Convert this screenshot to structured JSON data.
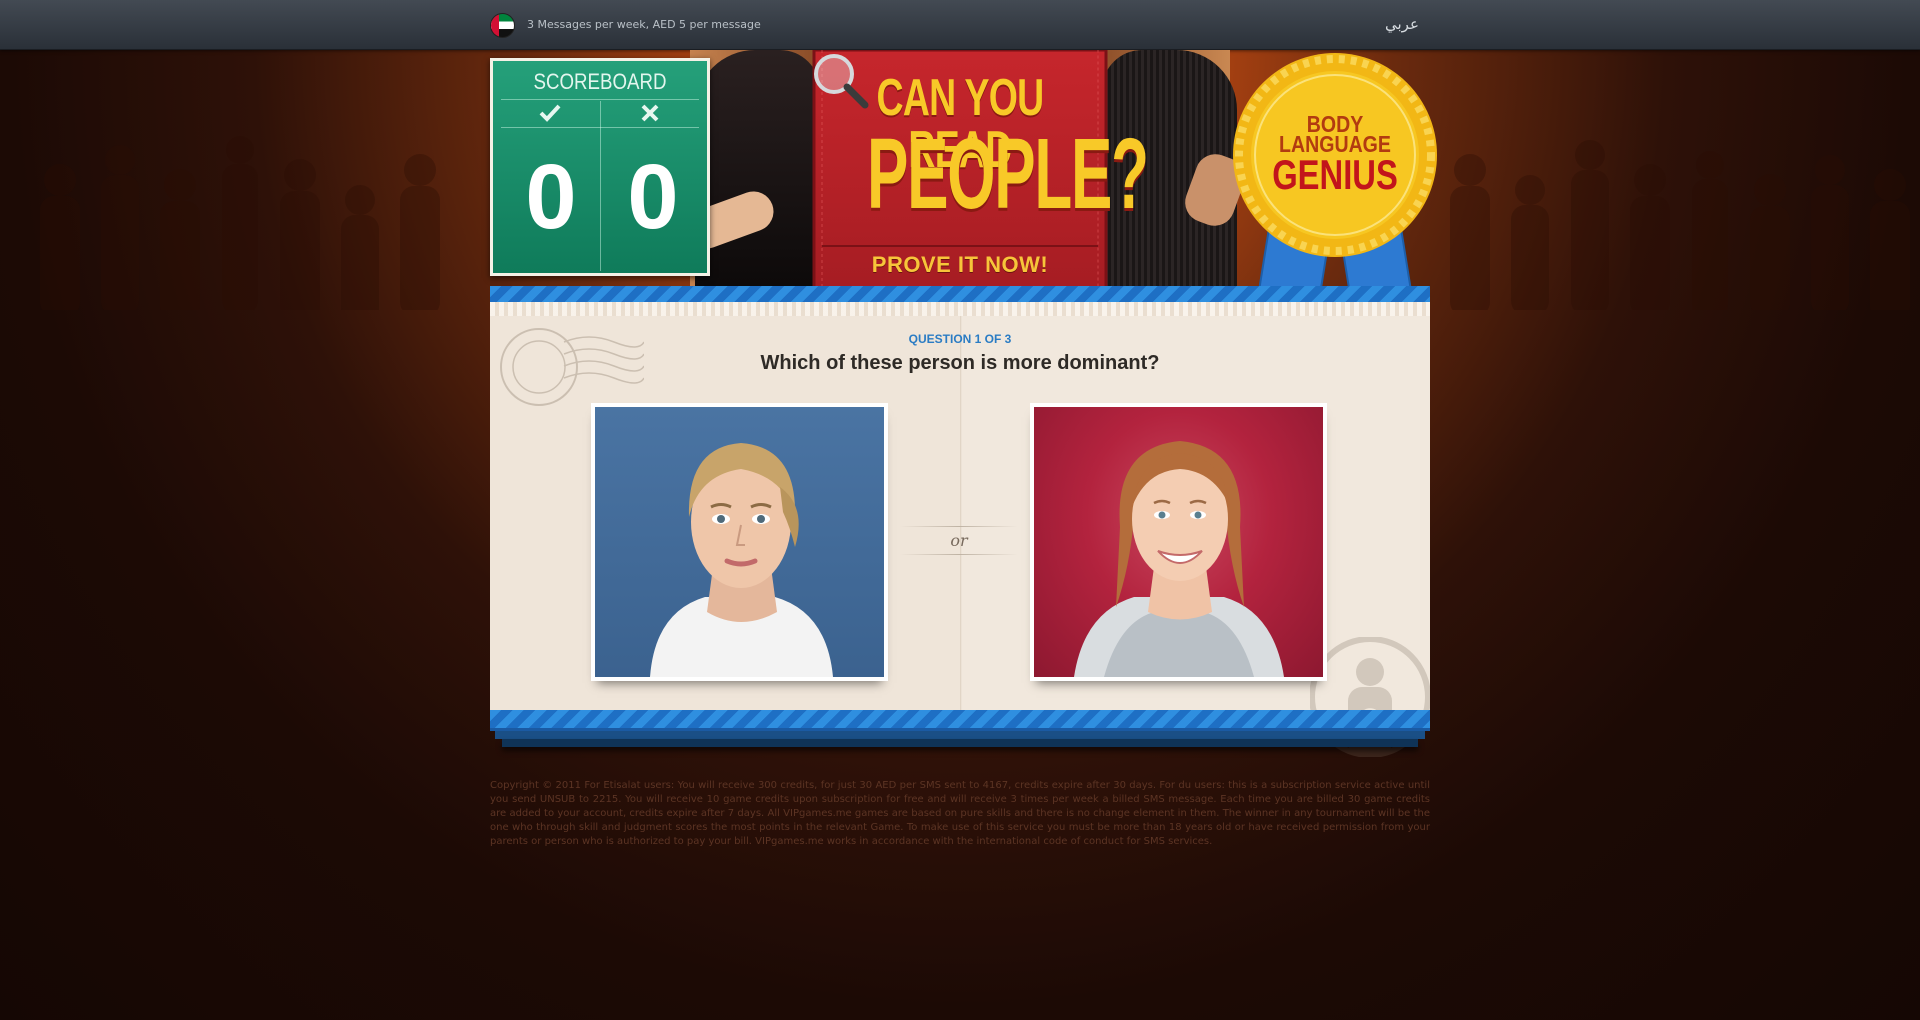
{
  "topbar": {
    "flag_icon": "uae-flag-icon",
    "notice": "3 Messages per week, AED 5 per message",
    "language_link": "عربي"
  },
  "scoreboard": {
    "title": "SCOREBOARD",
    "correct_icon": "checkmark-icon",
    "wrong_icon": "cross-icon",
    "correct_score": "0",
    "wrong_score": "0"
  },
  "banner": {
    "line1": "CAN YOU READ",
    "line2": "PEOPLE?",
    "cta": "PROVE IT NOW!"
  },
  "badge": {
    "line1": "BODY",
    "line2": "LANGUAGE",
    "line3": "GENIUS"
  },
  "quiz": {
    "question_number": "QUESTION 1 OF 3",
    "question": "Which of these person is more dominant?",
    "separator": "or",
    "options": [
      {
        "id": "option-a",
        "description_icon": "portrait-blonde-serious"
      },
      {
        "id": "option-b",
        "description_icon": "portrait-redhead-smiling"
      }
    ]
  },
  "footer": {
    "legal": "Copyright © 2011 For Etisalat users: You will receive 300 credits, for just 30 AED per SMS sent to 4167, credits expire after 30 days. For du users: this is a subscription service active until you send UNSUB to 2215. You will receive 10 game credits upon subscription for free and will receive 3 times per week a billed SMS message. Each time you are billed 30 game credits are added to your account, credits expire after 7 days. All VIPgames.me games are based on pure skills and there is no change element in them. The winner in any tournament will be the one who through skill and judgment scores the most points in the relevant Game. To make use of this service you must be more than 18 years old or have received permission from your parents or person who is authorized to pay your bill. VIPgames.me works in accordance with the international code of conduct for SMS services."
  },
  "colors": {
    "scoreboard_green": "#1a8f6a",
    "banner_red": "#b8232b",
    "banner_text_yellow": "#f8c928",
    "stripe_blue": "#2f8fe0",
    "question_blue": "#2a7cc4",
    "badge_gold": "#f5c21b",
    "ribbon_blue": "#2d7ad2"
  }
}
